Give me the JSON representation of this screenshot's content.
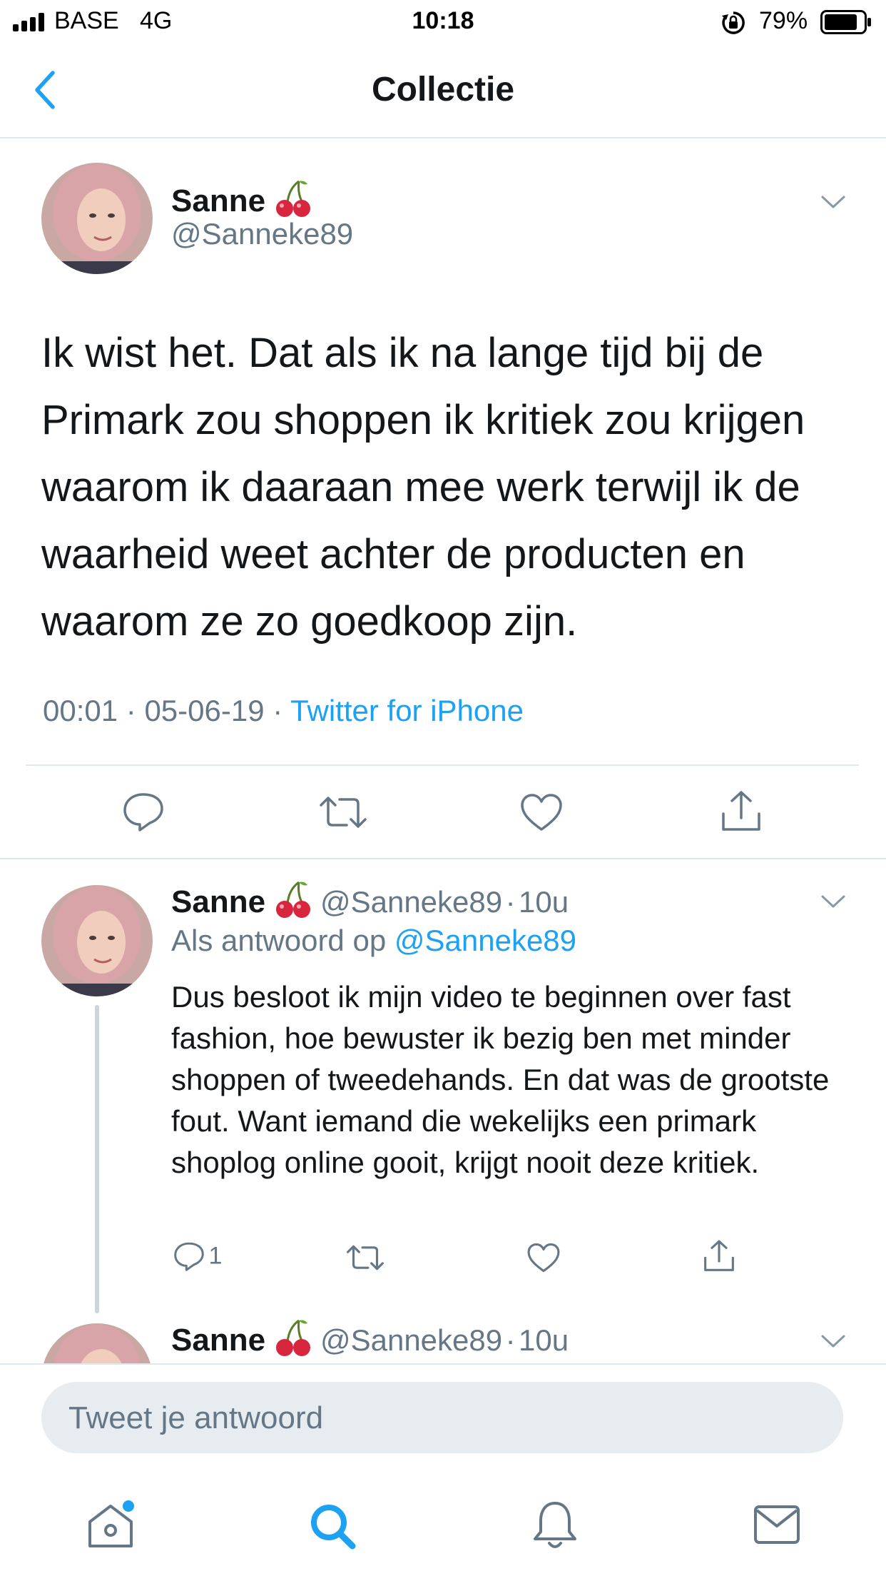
{
  "status": {
    "carrier": "BASE",
    "network": "4G",
    "time": "10:18",
    "battery": "79%"
  },
  "nav": {
    "title": "Collectie"
  },
  "main_tweet": {
    "name": "Sanne",
    "handle": "@Sanneke89",
    "text": "Ik wist het. Dat als ik na lange tijd bij de Primark zou shoppen ik kritiek zou krijgen waarom ik daaraan mee werk terwijl ik de waarheid weet achter de producten en waarom ze zo goedkoop zijn.",
    "time": "00:01",
    "dot1": "·",
    "date": "05-06-19",
    "dot2": "·",
    "source": "Twitter for iPhone"
  },
  "reply1": {
    "name": "Sanne",
    "handle": "@Sanneke89",
    "dot": "·",
    "time": "10u",
    "reply_prefix": "Als antwoord op",
    "reply_to": "@Sanneke89",
    "text": "Dus besloot ik mijn video te beginnen over fast fashion, hoe bewuster ik bezig ben met minder shoppen of tweedehands. En dat was de grootste fout. Want iemand die wekelijks een primark shoplog online gooit, krijgt nooit deze kritiek.",
    "reply_count": "1"
  },
  "reply2": {
    "name": "Sanne",
    "handle": "@Sanneke89",
    "dot": "·",
    "time": "10u"
  },
  "composer": {
    "placeholder": "Tweet je antwoord"
  },
  "icons": {
    "emoji": "cherries-icon",
    "tabs": [
      "home-icon",
      "search-icon",
      "notifications-icon",
      "messages-icon"
    ]
  },
  "colors": {
    "accent": "#1da1f2",
    "secondary_text": "#657786",
    "divider": "#e1e8ed"
  }
}
